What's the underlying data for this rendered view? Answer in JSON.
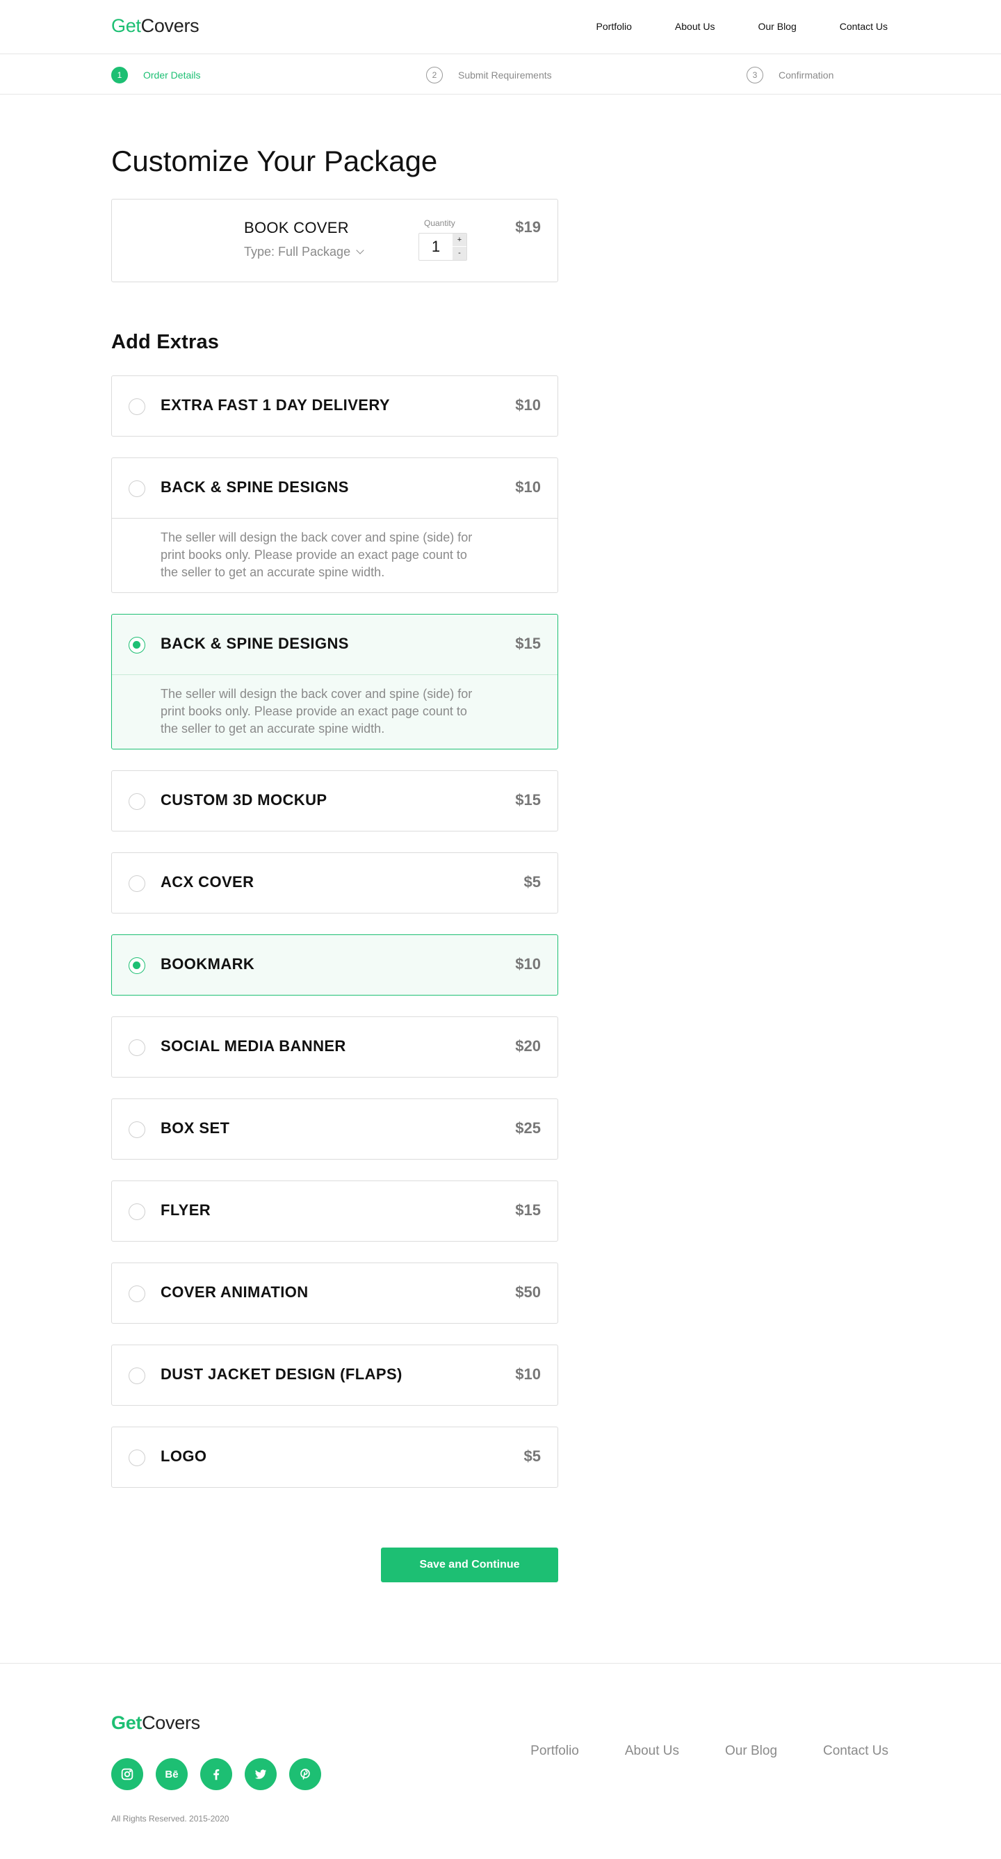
{
  "brand": {
    "part1": "Get",
    "part2": "Covers"
  },
  "nav": {
    "items": [
      "Portfolio",
      "About Us",
      "Our Blog",
      "Contact Us"
    ]
  },
  "steps": [
    {
      "num": "1",
      "label": "Order Details",
      "active": true
    },
    {
      "num": "2",
      "label": "Submit Requirements",
      "active": false
    },
    {
      "num": "3",
      "label": "Confirmation",
      "active": false
    }
  ],
  "page_title": "Customize Your Package",
  "package": {
    "name": "BOOK COVER",
    "type": "Type: Full Package",
    "quantity_label": "Quantity",
    "quantity": "1",
    "inc_label": "+",
    "dec_label": "-",
    "price": "$19"
  },
  "extras_title": "Add Extras",
  "extras": [
    {
      "name": "EXTRA FAST 1 DAY DELIVERY",
      "price": "$10",
      "selected": false,
      "description": ""
    },
    {
      "name": "BACK & SPINE DESIGNS",
      "price": "$10",
      "selected": false,
      "description": "The seller will design the back cover and spine (side) for print books only. Please provide an exact page count to the seller to get an accurate spine width."
    },
    {
      "name": "BACK & SPINE DESIGNS",
      "price": "$15",
      "selected": true,
      "description": "The seller will design the back cover and spine (side) for print books only. Please provide an exact page count to the seller to get an accurate spine width."
    },
    {
      "name": "CUSTOM 3D MOCKUP",
      "price": "$15",
      "selected": false,
      "description": ""
    },
    {
      "name": "ACX COVER",
      "price": "$5",
      "selected": false,
      "description": ""
    },
    {
      "name": "BOOKMARK",
      "price": "$10",
      "selected": true,
      "description": ""
    },
    {
      "name": "SOCIAL MEDIA BANNER",
      "price": "$20",
      "selected": false,
      "description": ""
    },
    {
      "name": "BOX SET",
      "price": "$25",
      "selected": false,
      "description": ""
    },
    {
      "name": "FLYER",
      "price": "$15",
      "selected": false,
      "description": ""
    },
    {
      "name": "COVER ANIMATION",
      "price": "$50",
      "selected": false,
      "description": ""
    },
    {
      "name": "DUST JACKET DESIGN (FLAPS)",
      "price": "$10",
      "selected": false,
      "description": ""
    },
    {
      "name": "LOGO",
      "price": "$5",
      "selected": false,
      "description": ""
    }
  ],
  "save_button": "Save and Continue",
  "footer": {
    "social": [
      {
        "icon": "instagram-icon"
      },
      {
        "icon": "behance-icon",
        "glyph": "Bē"
      },
      {
        "icon": "facebook-icon"
      },
      {
        "icon": "twitter-icon"
      },
      {
        "icon": "pinterest-icon"
      }
    ],
    "copyright": "All Rights Reserved. 2015-2020",
    "nav": [
      "Portfolio",
      "About Us",
      "Our Blog",
      "Contact Us"
    ]
  },
  "colors": {
    "accent": "#1dbf73",
    "selected_bg": "#f3fbf7",
    "muted": "#8a8a8a",
    "border": "#dcdcdc"
  }
}
